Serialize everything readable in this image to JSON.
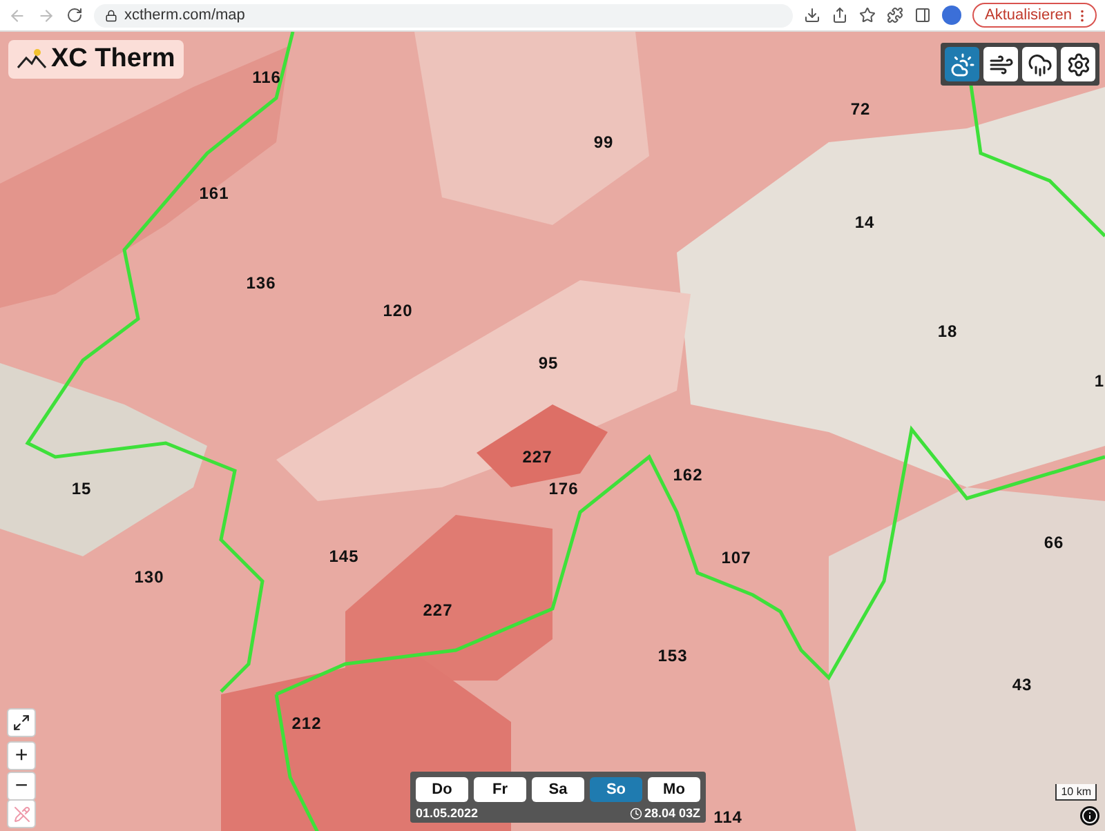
{
  "browser": {
    "url": "xctherm.com/map",
    "update_button": "Aktualisieren"
  },
  "app": {
    "title": "XC Therm"
  },
  "layer_buttons": [
    {
      "kind": "thermal",
      "selected": true
    },
    {
      "kind": "wind",
      "selected": false
    },
    {
      "kind": "weather",
      "selected": false
    },
    {
      "kind": "settings",
      "selected": false
    }
  ],
  "regions": [
    {
      "value": "116"
    },
    {
      "value": "99"
    },
    {
      "value": "72"
    },
    {
      "value": "161"
    },
    {
      "value": "14"
    },
    {
      "value": "136"
    },
    {
      "value": "120"
    },
    {
      "value": "18"
    },
    {
      "value": "95"
    },
    {
      "value": "1"
    },
    {
      "value": "227"
    },
    {
      "value": "176"
    },
    {
      "value": "162"
    },
    {
      "value": "15"
    },
    {
      "value": "145"
    },
    {
      "value": "107"
    },
    {
      "value": "66"
    },
    {
      "value": "130"
    },
    {
      "value": "227"
    },
    {
      "value": "153"
    },
    {
      "value": "43"
    },
    {
      "value": "212"
    },
    {
      "value": "114"
    }
  ],
  "map_controls": {
    "zoom_in": "+",
    "zoom_out": "−"
  },
  "scale": "10 km",
  "day_tabs": [
    {
      "label": "Do",
      "selected": false
    },
    {
      "label": "Fr",
      "selected": false
    },
    {
      "label": "Sa",
      "selected": false
    },
    {
      "label": "So",
      "selected": true
    },
    {
      "label": "Mo",
      "selected": false
    }
  ],
  "date": "01.05.2022",
  "run_time": "28.04 03Z"
}
